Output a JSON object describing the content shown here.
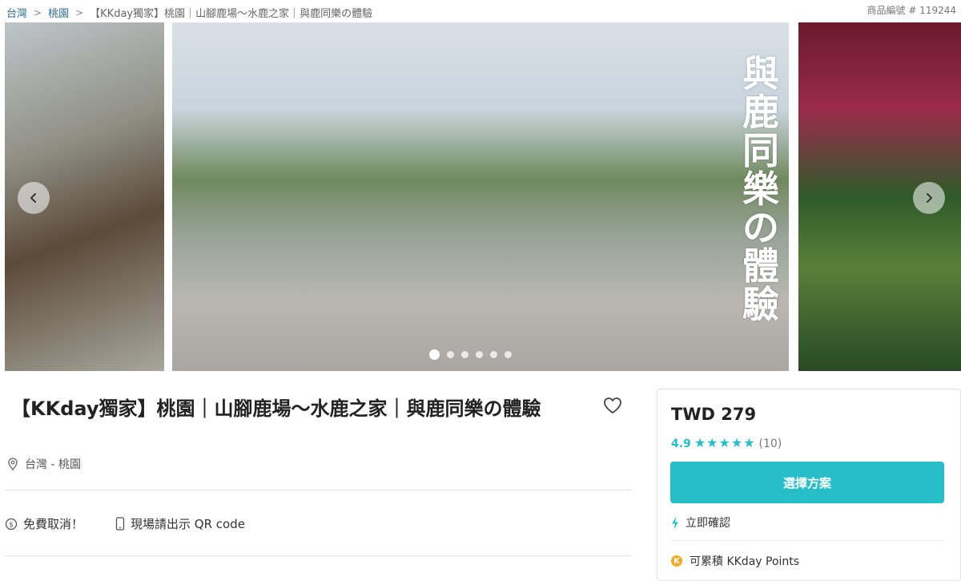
{
  "breadcrumb": {
    "items": [
      "台灣",
      "桃園"
    ],
    "current": "【KKday獨家】桃園｜山腳鹿場～水鹿之家｜與鹿同樂の體驗"
  },
  "product_code": "商品編號 # 119244",
  "gallery": {
    "overlay_text": [
      "與",
      "鹿",
      "同",
      "樂",
      "の",
      "體",
      "驗"
    ],
    "dot_count": 6,
    "active_dot": 1
  },
  "product": {
    "title": "【KKday獨家】桃園｜山腳鹿場～水鹿之家｜與鹿同樂の體驗",
    "location": "台灣 - 桃園",
    "features": [
      "免費取消！",
      "現場請出示 QR code"
    ]
  },
  "booking": {
    "price": "TWD 279",
    "rating_score": "4.9",
    "stars": 5,
    "review_count": "(10)",
    "select_button": "選擇方案",
    "instant_confirm": "立即確認",
    "points_coin": "K",
    "points": "可累積 KKday Points"
  },
  "colors": {
    "accent": "#26bec9",
    "link": "#2b6c8f",
    "coin": "#f4a924"
  }
}
